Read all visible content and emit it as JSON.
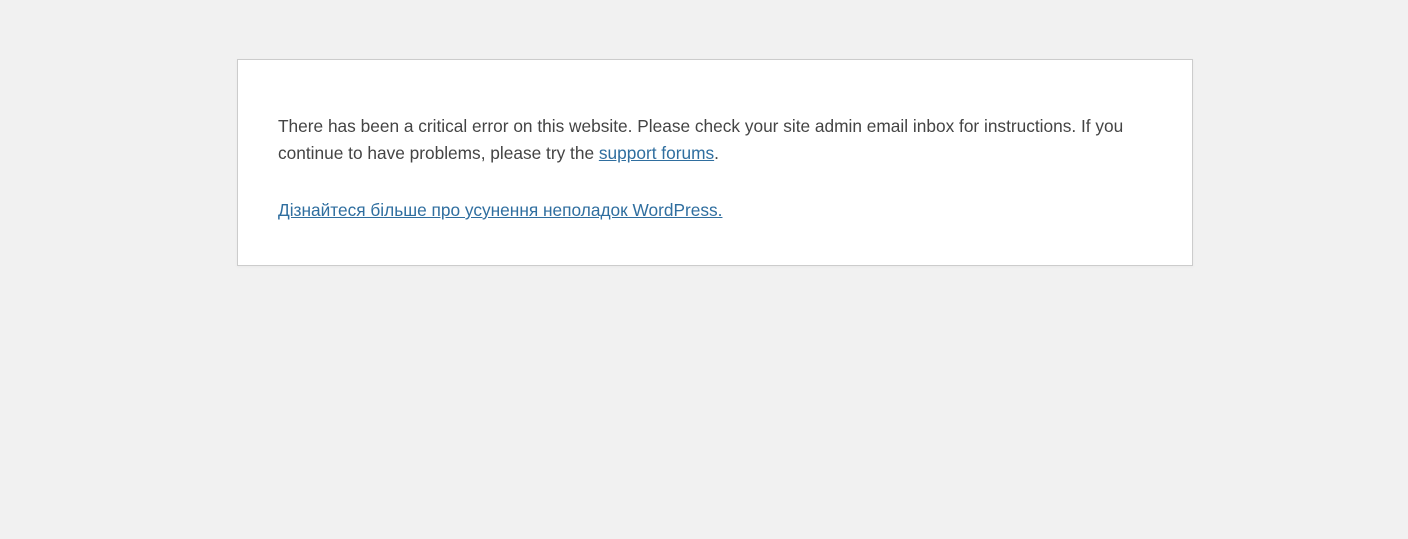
{
  "error": {
    "message_before_link": "There has been a critical error on this website. Please check your site admin email inbox for instructions. If you continue to have problems, please try the ",
    "support_link_label": "support forums",
    "message_after_link": ".",
    "learn_more_label": "Дізнайтеся більше про усунення неполадок WordPress."
  },
  "colors": {
    "background": "#f1f1f1",
    "panel": "#ffffff",
    "text": "#444444",
    "link": "#2f6e9f"
  }
}
